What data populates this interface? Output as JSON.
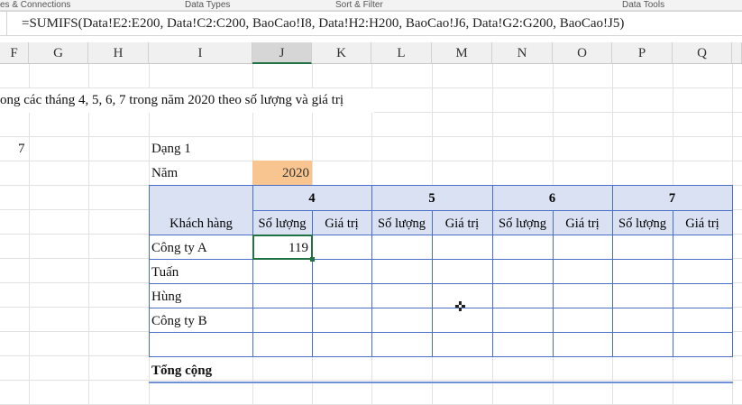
{
  "ribbon": {
    "groups": [
      "es & Connections",
      "Data Types",
      "Sort & Filter",
      "Data Tools"
    ]
  },
  "formula_bar": {
    "value": "=SUMIFS(Data!E2:E200, Data!C2:C200, BaoCao!I8, Data!H2:H200, BaoCao!J6, Data!G2:G200, BaoCao!J5)"
  },
  "columns": [
    "F",
    "G",
    "H",
    "I",
    "J",
    "K",
    "L",
    "M",
    "N",
    "O",
    "P",
    "Q"
  ],
  "selected_column": "J",
  "sheet": {
    "title": "ong các tháng 4, 5, 6, 7 trong năm 2020 theo số lượng và giá trị",
    "f_value": "7",
    "dang_label": "Dạng 1",
    "nam_label": "Năm",
    "nam_value": "2020",
    "customer_header": "Khách hàng",
    "months": [
      "4",
      "5",
      "6",
      "7"
    ],
    "sub_headers": {
      "qty": "Số lượng",
      "value": "Giá trị"
    },
    "customers": [
      "Công ty A",
      "Tuấn",
      "Hùng",
      "Công ty B"
    ],
    "active_cell_value": "119",
    "total_label": "Tổng cộng"
  },
  "colors": {
    "header_fill": "#d9e1f2",
    "year_fill": "#f8c48f",
    "border": "#4a6fc8",
    "selection": "#217346"
  }
}
